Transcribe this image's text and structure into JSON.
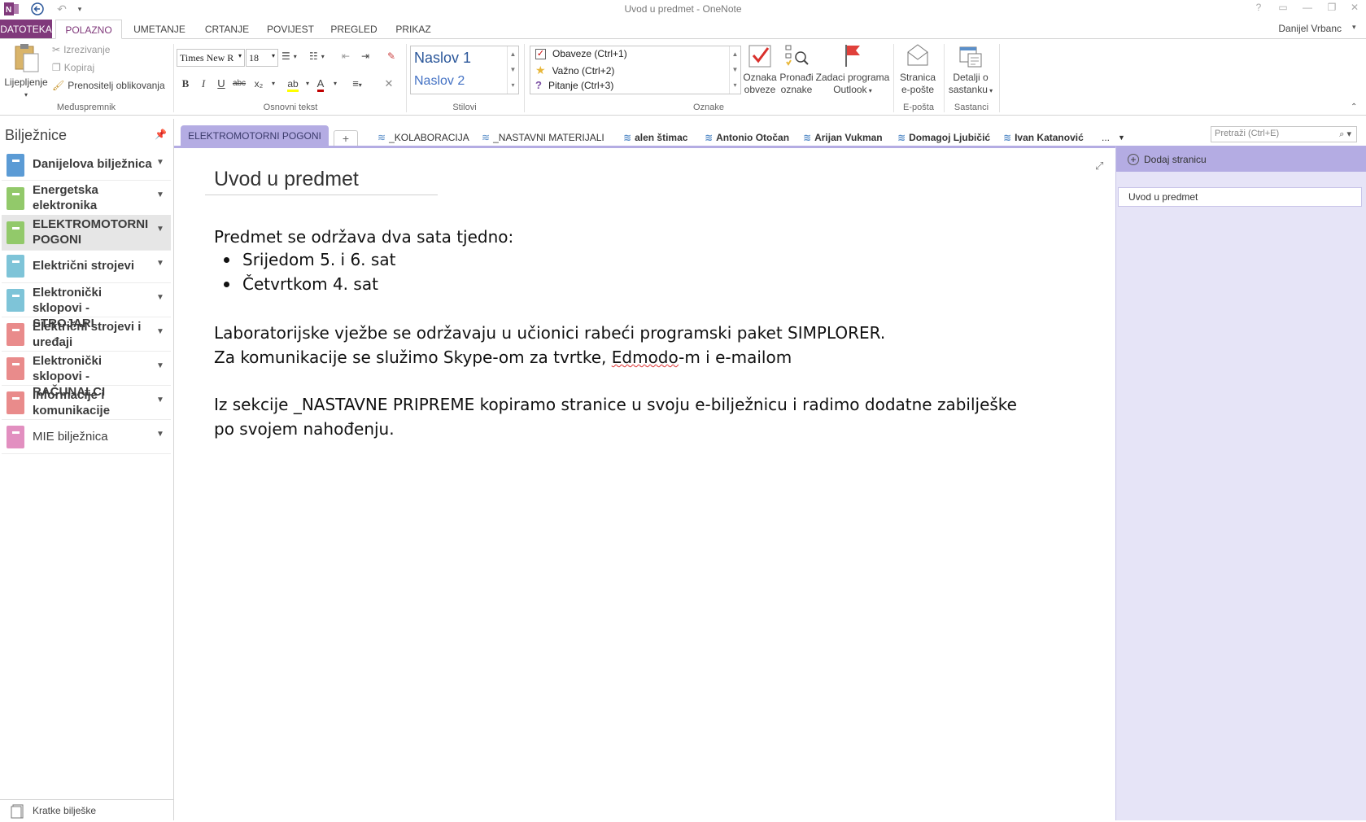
{
  "window": {
    "title": "Uvod u predmet - OneNote",
    "user": "Danijel Vrbanc"
  },
  "ribbon_tabs": [
    "DATOTEKA",
    "POLAZNO",
    "UMETANJE",
    "CRTANJE",
    "POVIJEST",
    "PREGLED",
    "PRIKAZ"
  ],
  "ribbon": {
    "clipboard": {
      "paste": "Lijepljenje",
      "cut": "Izrezivanje",
      "copy": "Kopiraj",
      "format_painter": "Prenositelj oblikovanja",
      "label": "Međuspremnik"
    },
    "basic_text": {
      "font": "Times New R",
      "size": "18",
      "label": "Osnovni tekst"
    },
    "styles": {
      "heading1": "Naslov 1",
      "heading2": "Naslov 2",
      "label": "Stilovi"
    },
    "tags": {
      "todo": "Obaveze (Ctrl+1)",
      "important": "Važno (Ctrl+2)",
      "question": "Pitanje (Ctrl+3)",
      "todo_tag_1": "Oznaka",
      "todo_tag_2": "obveze",
      "find_tags_1": "Pronađi",
      "find_tags_2": "oznake",
      "outlook_1": "Zadaci programa",
      "outlook_2": "Outlook",
      "label": "Oznake"
    },
    "email": {
      "label_1": "Stranica",
      "label_2": "e-pošte",
      "label": "E-pošta"
    },
    "meetings": {
      "label_1": "Detalji o",
      "label_2": "sastanku",
      "label": "Sastanci"
    }
  },
  "notebooks": {
    "header": "Bilježnice",
    "items": [
      {
        "label": "Danijelova bilježnica",
        "color": "#5b9bd5"
      },
      {
        "label": "Energetska elektronika",
        "color": "#92c96a"
      },
      {
        "label": "ELEKTROMOTORNI POGONI",
        "color": "#92c96a"
      },
      {
        "label": "Električni strojevi",
        "color": "#7ec4d8"
      },
      {
        "label": "Elektronički sklopovi - STROJARI",
        "color": "#7ec4d8"
      },
      {
        "label": "Električni strojevi i uređaji",
        "color": "#e98b8b"
      },
      {
        "label": "Elektronički sklopovi - RAČUNALCI",
        "color": "#e98b8b"
      },
      {
        "label": "Informacije i komunikacije",
        "color": "#e98b8b"
      },
      {
        "label": "MIE bilježnica",
        "color": "#e28fc0"
      }
    ],
    "quick_notes": "Kratke bilješke"
  },
  "sections": {
    "active": "ELEKTROMOTORNI POGONI",
    "groups": [
      "_KOLABORACIJA",
      "_NASTAVNI MATERIJALI",
      "alen štimac",
      "Antonio Otočan",
      "Arijan Vukman",
      "Domagoj Ljubičić",
      "Ivan Katanović"
    ],
    "more": "..."
  },
  "search": {
    "placeholder": "Pretraži (Ctrl+E)"
  },
  "page": {
    "title": "Uvod u predmet",
    "line1": "Predmet se održava dva sata tjedno:",
    "bullet1": "Srijedom 5. i 6. sat",
    "bullet2": "Četvrtkom 4. sat",
    "line2": "Laboratorijske vježbe se održavaju u učionici rabeći programski paket SIMPLORER.",
    "line3_a": "Za komunikacije se služimo Skype-om za tvrtke, ",
    "line3_b": "Edmodo",
    "line3_c": "-m i e-mailom",
    "line4": "Iz sekcije _NASTAVNE PRIPREME kopiramo stranice u svoju e-bilježnicu i radimo dodatne zabilješke",
    "line5": "po svojem nahođenju."
  },
  "pages_pane": {
    "add_page": "Dodaj stranicu",
    "items": [
      "Uvod u predmet"
    ]
  },
  "colors": {
    "accent": "#80397b",
    "section": "#b4ace3",
    "page_list_bg": "#e6e4f7"
  }
}
